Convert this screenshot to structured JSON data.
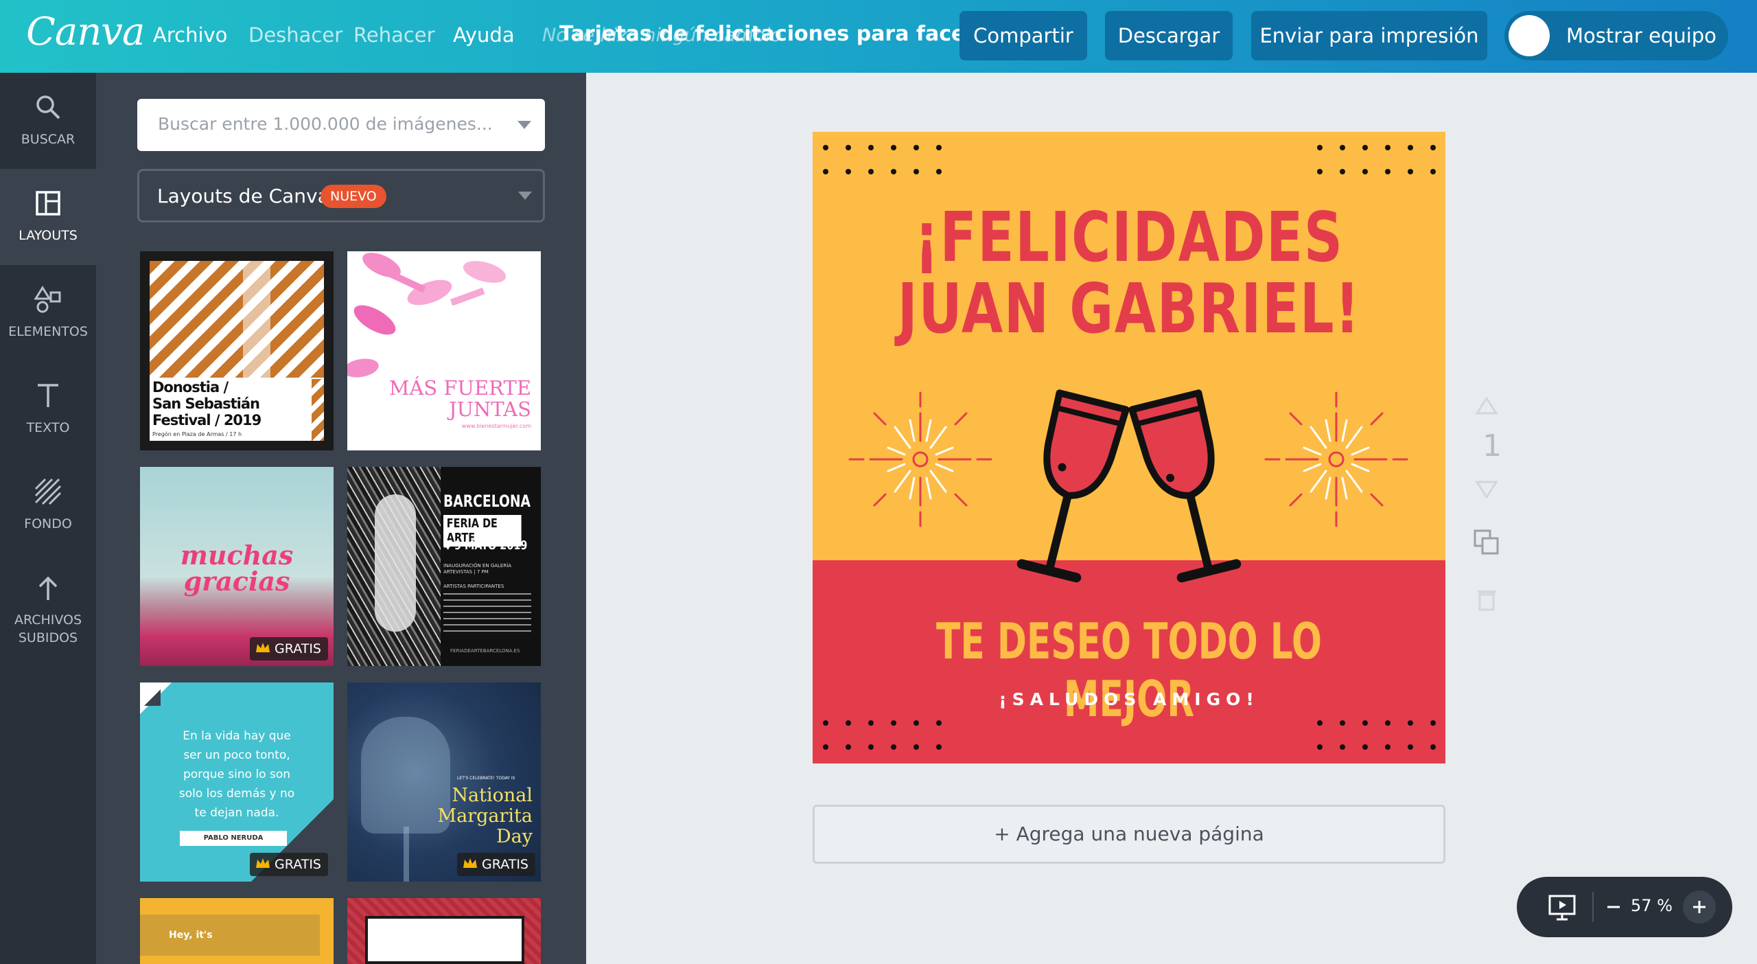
{
  "app": {
    "logo": "Canva"
  },
  "menu": {
    "archivo": "Archivo",
    "deshacer": "Deshacer",
    "rehacer": "Rehacer",
    "ayuda": "Ayuda",
    "status": "No se hizo ningún cambio"
  },
  "document": {
    "title": "Tarjetas de felicitaciones para facebook"
  },
  "toolbar": {
    "share": "Compartir",
    "download": "Descargar",
    "print": "Enviar para impresión",
    "team": "Mostrar equipo"
  },
  "rail": [
    {
      "label": "BUSCAR",
      "icon": "search-icon"
    },
    {
      "label": "LAYOUTS",
      "icon": "layouts-icon"
    },
    {
      "label": "ELEMENTOS",
      "icon": "elements-icon"
    },
    {
      "label": "TEXTO",
      "icon": "text-icon"
    },
    {
      "label": "FONDO",
      "icon": "background-icon"
    },
    {
      "label": "ARCHIVOS SUBIDOS",
      "icon": "upload-icon"
    }
  ],
  "panel": {
    "search_placeholder": "Buscar entre 1.000.000 de imágenes...",
    "layouts_label": "Layouts de Canva",
    "new_badge": "NUEVO",
    "templates": [
      {
        "lines": [
          "Donostia /",
          "San Sebastián",
          "Festival / 2019"
        ],
        "caption": "Pregón en Plaza de Armas / 17 h"
      },
      {
        "lines": [
          "MÁS FUERTE",
          "JUNTAS"
        ],
        "caption": "www.bienestarmujer.com"
      },
      {
        "lines": [
          "muchas",
          "gracias"
        ],
        "badge": "GRATIS"
      },
      {
        "lines": [
          "BARCELONA",
          "FERIA DE ARTE",
          "4-9 MAYO 2019"
        ],
        "caption": "INAUGURACIÓN EN GALERÍA ARTEVISTAS | 7 PM",
        "small": "ARTISTAS PARTICIPANTES",
        "url": "FERIADEARTEBARCELONA.ES"
      },
      {
        "lines": [
          "En la vida hay que",
          "ser un poco tonto,",
          "porque sino lo son",
          "solo los demás y no",
          "te dejan nada."
        ],
        "author": "PABLO NERUDA",
        "badge": "GRATIS"
      },
      {
        "lines": [
          "National",
          "Margarita",
          "Day"
        ],
        "small": "LET'S CELEBRATE! TODAY IS",
        "badge": "GRATIS"
      },
      {
        "lines": [
          "Hey, it's"
        ]
      }
    ]
  },
  "design": {
    "title_line1": "¡FELICIDADES",
    "title_line2": "JUAN GABRIEL!",
    "subtitle": "TE DESEO TODO LO MEJOR",
    "small": "¡SALUDOS AMIGO!"
  },
  "page": {
    "number": "1",
    "add_page": "+ Agrega una nueva página"
  },
  "zoom": {
    "value": "57 %"
  },
  "colors": {
    "accent_yellow": "#fdbc45",
    "accent_red": "#e33d4c",
    "topbar_teal": "#22c1c8",
    "topbar_blue": "#1580c4"
  }
}
